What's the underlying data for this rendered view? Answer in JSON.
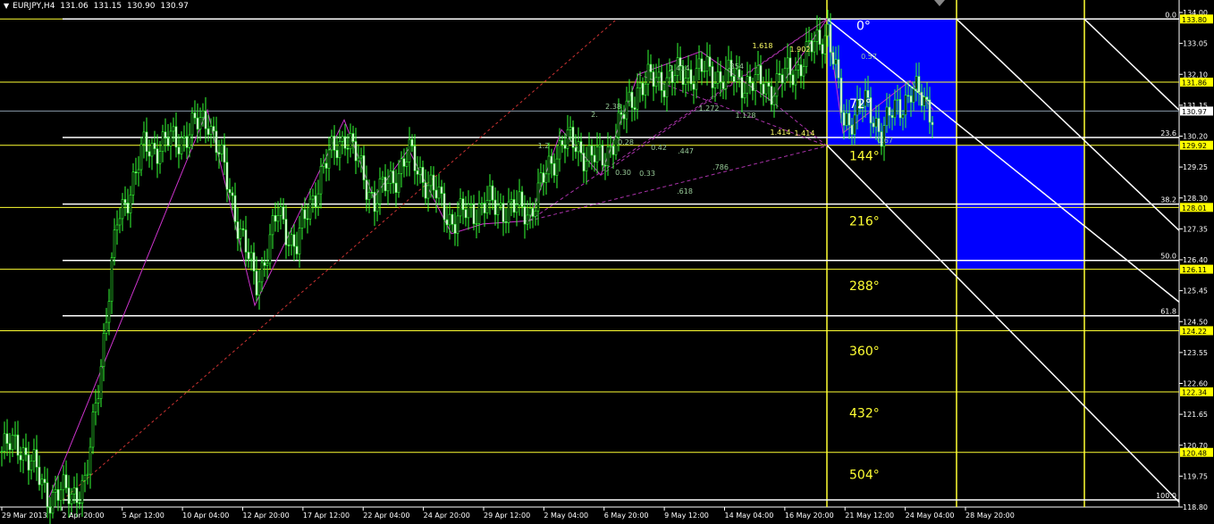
{
  "header": {
    "symbol": "EURJPY,H4",
    "open": "131.06",
    "high": "131.15",
    "low": "130.90",
    "close": "130.97"
  },
  "colors": {
    "background": "#000000",
    "candles": "#33ff33",
    "horizontal_lines": "#ffff33",
    "fib_lines": "#ffffff",
    "gann_box": "#0000ff",
    "harmonic_lines": "#cc33cc",
    "price_badge": "#ffff00"
  },
  "chart_data": {
    "type": "candlestick",
    "symbol": "EURJPY",
    "timeframe": "H4",
    "ylim": [
      118.8,
      134.0
    ],
    "y_ticks": [
      "134.00",
      "133.05",
      "132.10",
      "131.15",
      "130.20",
      "129.25",
      "128.30",
      "127.35",
      "126.40",
      "125.45",
      "124.50",
      "123.55",
      "122.60",
      "121.65",
      "120.70",
      "119.75",
      "118.80"
    ],
    "x_ticks": [
      "29 Mar 2013",
      "2 Apr 20:00",
      "5 Apr 12:00",
      "10 Apr 04:00",
      "12 Apr 20:00",
      "17 Apr 12:00",
      "22 Apr 04:00",
      "24 Apr 20:00",
      "29 Apr 12:00",
      "2 May 04:00",
      "6 May 20:00",
      "9 May 12:00",
      "14 May 04:00",
      "16 May 20:00",
      "21 May 12:00",
      "24 May 04:00",
      "28 May 20:00"
    ],
    "price_badges": [
      {
        "value": 133.8,
        "text": "133.80"
      },
      {
        "value": 131.86,
        "text": "131.86"
      },
      {
        "value": 130.97,
        "text": "130.97",
        "current": true
      },
      {
        "value": 129.92,
        "text": "129.92"
      },
      {
        "value": 128.01,
        "text": "128.01"
      },
      {
        "value": 126.11,
        "text": "126.11"
      },
      {
        "value": 124.22,
        "text": "124.22"
      },
      {
        "value": 122.34,
        "text": "122.34"
      },
      {
        "value": 120.48,
        "text": "120.48"
      }
    ],
    "fibonacci_levels": [
      {
        "label": "0.0",
        "value": 133.8
      },
      {
        "label": "23.6",
        "value": 130.16
      },
      {
        "label": "38.2",
        "value": 128.11
      },
      {
        "label": "50.0",
        "value": 126.38
      },
      {
        "label": "61.8",
        "value": 124.68
      },
      {
        "label": "100.0",
        "value": 119.02
      }
    ],
    "gann_angles": [
      "0°",
      "72°",
      "144°",
      "216°",
      "288°",
      "360°",
      "432°",
      "504°"
    ],
    "harmonic_ratios": [
      "1.618",
      "1.902",
      ".854",
      "1.414",
      "2.",
      "2.38",
      "1.272",
      "1.128",
      "1.414",
      "1.414",
      "1.2",
      ".447",
      "0.42",
      "0.28",
      "0.30",
      "0.33",
      ".786",
      ".618",
      "0.57",
      "0.67"
    ],
    "candles": [
      {
        "time": "29 Mar 2013",
        "open": 120.6,
        "high": 121.2,
        "low": 120.2,
        "close": 120.9
      },
      {
        "time": "2 Apr 20:00",
        "open": 119.5,
        "high": 120.2,
        "low": 119.0,
        "close": 119.9
      },
      {
        "time": "5 Apr 12:00",
        "open": 127.5,
        "high": 128.5,
        "low": 127.0,
        "close": 128.2
      },
      {
        "time": "10 Apr 04:00",
        "open": 130.2,
        "high": 131.0,
        "low": 129.6,
        "close": 130.5
      },
      {
        "time": "12 Apr 20:00",
        "open": 126.5,
        "high": 127.4,
        "low": 125.0,
        "close": 126.9
      },
      {
        "time": "17 Apr 12:00",
        "open": 128.6,
        "high": 129.6,
        "low": 128.2,
        "close": 129.1
      },
      {
        "time": "22 Apr 04:00",
        "open": 128.9,
        "high": 129.5,
        "low": 128.0,
        "close": 128.4
      },
      {
        "time": "24 Apr 20:00",
        "open": 128.1,
        "high": 128.8,
        "low": 127.4,
        "close": 127.8
      },
      {
        "time": "29 Apr 12:00",
        "open": 128.0,
        "high": 128.6,
        "low": 127.5,
        "close": 128.3
      },
      {
        "time": "2 May 04:00",
        "open": 129.6,
        "high": 130.4,
        "low": 129.1,
        "close": 130.1
      },
      {
        "time": "6 May 20:00",
        "open": 129.7,
        "high": 130.5,
        "low": 129.3,
        "close": 130.2
      },
      {
        "time": "9 May 12:00",
        "open": 131.9,
        "high": 132.5,
        "low": 131.4,
        "close": 132.1
      },
      {
        "time": "14 May 04:00",
        "open": 131.9,
        "high": 132.7,
        "low": 131.4,
        "close": 132.3
      },
      {
        "time": "16 May 20:00",
        "open": 131.6,
        "high": 132.4,
        "low": 131.0,
        "close": 131.9
      },
      {
        "time": "21 May 12:00",
        "open": 132.9,
        "high": 133.8,
        "low": 130.0,
        "close": 131.0
      },
      {
        "time": "24 May 04:00",
        "open": 130.7,
        "high": 131.4,
        "low": 130.1,
        "close": 130.9
      },
      {
        "time": "28 May 20:00",
        "open": 131.4,
        "high": 131.9,
        "low": 130.8,
        "close": 130.97
      }
    ]
  }
}
